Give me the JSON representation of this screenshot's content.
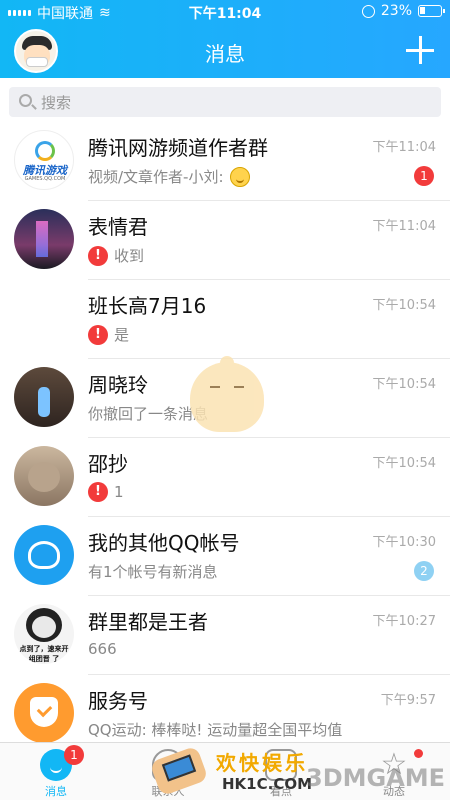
{
  "status_bar": {
    "carrier": "中国联通",
    "time": "下午11:04",
    "battery": "23%"
  },
  "header": {
    "title": "消息"
  },
  "search": {
    "placeholder": "搜索"
  },
  "conversations": [
    {
      "name": "腾讯网游频道作者群",
      "preview": "视频/文章作者-小刘: ",
      "time": "下午11:04",
      "badge": "1",
      "avatar_text": "腾讯游戏",
      "avatar_subtext": "GAMES.QQ.COM"
    },
    {
      "name": "表情君",
      "preview": "收到",
      "time": "下午11:04"
    },
    {
      "name": "班长高7月16",
      "preview": "是",
      "time": "下午10:54"
    },
    {
      "name": "周晓玲",
      "preview": "你撤回了一条消息",
      "time": "下午10:54"
    },
    {
      "name": "邵抄",
      "preview": "1",
      "time": "下午10:54"
    },
    {
      "name": "我的其他QQ帐号",
      "preview": "有1个帐号有新消息",
      "time": "下午10:30",
      "badge": "2"
    },
    {
      "name": "群里都是王者",
      "preview": "666",
      "time": "下午10:27",
      "avatar_text": "点到了，速来开 组团晋 了"
    },
    {
      "name": "服务号",
      "preview": "QQ运动: 棒棒哒! 运动量超全国平均值",
      "time": "下午9:57"
    }
  ],
  "tabbar": {
    "messages": "消息",
    "messages_badge": "1",
    "contacts": "联系人",
    "watch": "看点",
    "dynamic": "动态"
  },
  "watermark": {
    "text": "欢快娱乐",
    "url": "HK1C.COM",
    "brand": "3DMGAME"
  },
  "colors": {
    "header_start": "#12b7f5",
    "header_end": "#26a7ff",
    "badge_red": "#f23b3b",
    "badge_blue": "#8fd1f3"
  }
}
